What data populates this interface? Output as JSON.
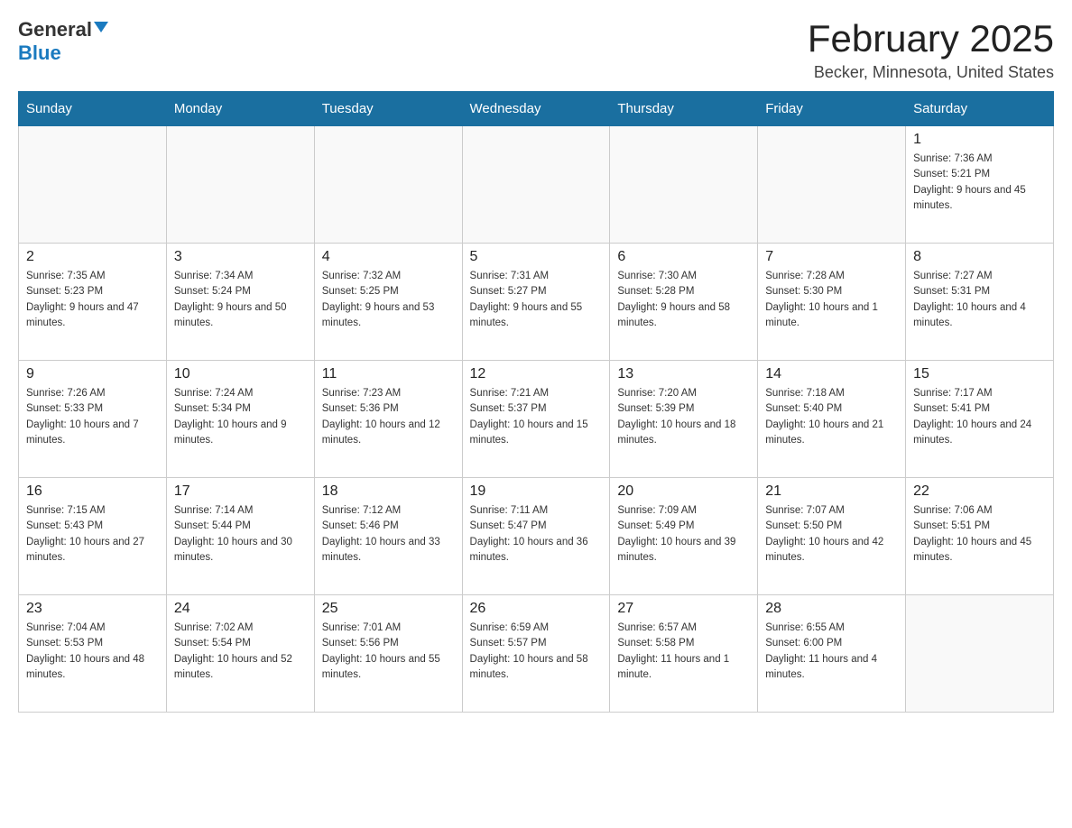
{
  "header": {
    "logo_general": "General",
    "logo_blue": "Blue",
    "month_title": "February 2025",
    "location": "Becker, Minnesota, United States"
  },
  "weekdays": [
    "Sunday",
    "Monday",
    "Tuesday",
    "Wednesday",
    "Thursday",
    "Friday",
    "Saturday"
  ],
  "weeks": [
    [
      {
        "day": "",
        "info": ""
      },
      {
        "day": "",
        "info": ""
      },
      {
        "day": "",
        "info": ""
      },
      {
        "day": "",
        "info": ""
      },
      {
        "day": "",
        "info": ""
      },
      {
        "day": "",
        "info": ""
      },
      {
        "day": "1",
        "info": "Sunrise: 7:36 AM\nSunset: 5:21 PM\nDaylight: 9 hours and 45 minutes."
      }
    ],
    [
      {
        "day": "2",
        "info": "Sunrise: 7:35 AM\nSunset: 5:23 PM\nDaylight: 9 hours and 47 minutes."
      },
      {
        "day": "3",
        "info": "Sunrise: 7:34 AM\nSunset: 5:24 PM\nDaylight: 9 hours and 50 minutes."
      },
      {
        "day": "4",
        "info": "Sunrise: 7:32 AM\nSunset: 5:25 PM\nDaylight: 9 hours and 53 minutes."
      },
      {
        "day": "5",
        "info": "Sunrise: 7:31 AM\nSunset: 5:27 PM\nDaylight: 9 hours and 55 minutes."
      },
      {
        "day": "6",
        "info": "Sunrise: 7:30 AM\nSunset: 5:28 PM\nDaylight: 9 hours and 58 minutes."
      },
      {
        "day": "7",
        "info": "Sunrise: 7:28 AM\nSunset: 5:30 PM\nDaylight: 10 hours and 1 minute."
      },
      {
        "day": "8",
        "info": "Sunrise: 7:27 AM\nSunset: 5:31 PM\nDaylight: 10 hours and 4 minutes."
      }
    ],
    [
      {
        "day": "9",
        "info": "Sunrise: 7:26 AM\nSunset: 5:33 PM\nDaylight: 10 hours and 7 minutes."
      },
      {
        "day": "10",
        "info": "Sunrise: 7:24 AM\nSunset: 5:34 PM\nDaylight: 10 hours and 9 minutes."
      },
      {
        "day": "11",
        "info": "Sunrise: 7:23 AM\nSunset: 5:36 PM\nDaylight: 10 hours and 12 minutes."
      },
      {
        "day": "12",
        "info": "Sunrise: 7:21 AM\nSunset: 5:37 PM\nDaylight: 10 hours and 15 minutes."
      },
      {
        "day": "13",
        "info": "Sunrise: 7:20 AM\nSunset: 5:39 PM\nDaylight: 10 hours and 18 minutes."
      },
      {
        "day": "14",
        "info": "Sunrise: 7:18 AM\nSunset: 5:40 PM\nDaylight: 10 hours and 21 minutes."
      },
      {
        "day": "15",
        "info": "Sunrise: 7:17 AM\nSunset: 5:41 PM\nDaylight: 10 hours and 24 minutes."
      }
    ],
    [
      {
        "day": "16",
        "info": "Sunrise: 7:15 AM\nSunset: 5:43 PM\nDaylight: 10 hours and 27 minutes."
      },
      {
        "day": "17",
        "info": "Sunrise: 7:14 AM\nSunset: 5:44 PM\nDaylight: 10 hours and 30 minutes."
      },
      {
        "day": "18",
        "info": "Sunrise: 7:12 AM\nSunset: 5:46 PM\nDaylight: 10 hours and 33 minutes."
      },
      {
        "day": "19",
        "info": "Sunrise: 7:11 AM\nSunset: 5:47 PM\nDaylight: 10 hours and 36 minutes."
      },
      {
        "day": "20",
        "info": "Sunrise: 7:09 AM\nSunset: 5:49 PM\nDaylight: 10 hours and 39 minutes."
      },
      {
        "day": "21",
        "info": "Sunrise: 7:07 AM\nSunset: 5:50 PM\nDaylight: 10 hours and 42 minutes."
      },
      {
        "day": "22",
        "info": "Sunrise: 7:06 AM\nSunset: 5:51 PM\nDaylight: 10 hours and 45 minutes."
      }
    ],
    [
      {
        "day": "23",
        "info": "Sunrise: 7:04 AM\nSunset: 5:53 PM\nDaylight: 10 hours and 48 minutes."
      },
      {
        "day": "24",
        "info": "Sunrise: 7:02 AM\nSunset: 5:54 PM\nDaylight: 10 hours and 52 minutes."
      },
      {
        "day": "25",
        "info": "Sunrise: 7:01 AM\nSunset: 5:56 PM\nDaylight: 10 hours and 55 minutes."
      },
      {
        "day": "26",
        "info": "Sunrise: 6:59 AM\nSunset: 5:57 PM\nDaylight: 10 hours and 58 minutes."
      },
      {
        "day": "27",
        "info": "Sunrise: 6:57 AM\nSunset: 5:58 PM\nDaylight: 11 hours and 1 minute."
      },
      {
        "day": "28",
        "info": "Sunrise: 6:55 AM\nSunset: 6:00 PM\nDaylight: 11 hours and 4 minutes."
      },
      {
        "day": "",
        "info": ""
      }
    ]
  ]
}
